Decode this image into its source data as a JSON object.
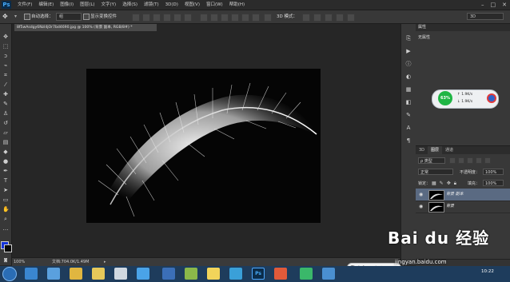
{
  "app": {
    "logo": "Ps",
    "window_controls": [
      "–",
      "□",
      "✕"
    ]
  },
  "menu": [
    "文件(F)",
    "编辑(E)",
    "图像(I)",
    "图层(L)",
    "文字(Y)",
    "选择(S)",
    "滤镜(T)",
    "3D(D)",
    "视图(V)",
    "窗口(W)",
    "帮助(H)"
  ],
  "options": {
    "auto_select_label": "自动选择：",
    "auto_select_value": "组",
    "transform_label": "显示变换控件",
    "mode_3d_label": "3D 模式：",
    "workspace_value": "3D"
  },
  "document": {
    "tab_title": "8f5wAsdgy6Nzl4jOr7bd4690.jpg @ 100% (背景 副本, RGB/8#) *",
    "zoom": "100%",
    "doc_size": "文档:704.0K/1.49M"
  },
  "properties": {
    "tab": "属性",
    "empty_label": "无属性"
  },
  "speed_widget": {
    "percent": "63%",
    "up_rate": "1.9K/s",
    "down_rate": "1.9K/s"
  },
  "layers": {
    "tabs": [
      "3D",
      "图层",
      "通道"
    ],
    "kind_label": "ρ 类型",
    "blend_mode": "正常",
    "opacity_label": "不透明度：",
    "opacity_value": "100%",
    "lock_label": "锁定：",
    "fill_label": "填充：",
    "fill_value": "100%",
    "items": [
      {
        "name": "背景 副本",
        "selected": true
      },
      {
        "name": "背景",
        "selected": false
      }
    ]
  },
  "taskbar": {
    "ime_text": "五 ☽ °, ■ ✿ ✶",
    "clock": "10:22"
  },
  "watermark": {
    "brand": "Bai du 经验",
    "url": "jingyan.baidu.com"
  },
  "colors": {
    "foreground": "#1533d8",
    "background": "#0a0a0a",
    "speed_green": "#1fb545",
    "taskbar": "#1e3c5c"
  }
}
